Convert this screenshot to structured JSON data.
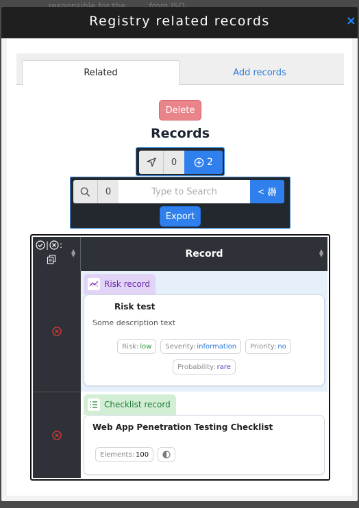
{
  "backdrop": {
    "text": "... ... responsible for the ... ... from ISO ..."
  },
  "modal": {
    "title": "Registry related records",
    "close_label": "×"
  },
  "tabs": [
    {
      "label": "Related",
      "active": true
    },
    {
      "label": "Add records",
      "active": false
    }
  ],
  "actions": {
    "delete_label": "Delete",
    "export_label": "Export"
  },
  "records_heading": "Records",
  "counter": {
    "left_count": "0",
    "right_count": "2"
  },
  "search": {
    "count": "0",
    "placeholder": "Type to Search",
    "value": "",
    "filter_prefix": "<"
  },
  "table": {
    "header_selectors": ":",
    "record_column": "Record",
    "rows": [
      {
        "badge": "Risk record",
        "title": "Risk test",
        "description": "Some description text",
        "chips": [
          {
            "label": "Risk:",
            "value": "low"
          },
          {
            "label": "Severity:",
            "value": "information"
          },
          {
            "label": "Priority:",
            "value": "no"
          },
          {
            "label": "Probability:",
            "value": "rare"
          }
        ]
      },
      {
        "badge": "Checklist record",
        "title": "Web App Penetration Testing Checklist",
        "chips": [
          {
            "label": "Elements:",
            "value": "100"
          }
        ]
      }
    ]
  },
  "colors": {
    "header_bg": "#1f1f1f",
    "accent_blue": "#2f80ed",
    "delete_red": "#e8848a",
    "risk_badge": "#e2d4f6",
    "checklist_badge": "#d2efd6",
    "table_dark": "#2e3138"
  }
}
